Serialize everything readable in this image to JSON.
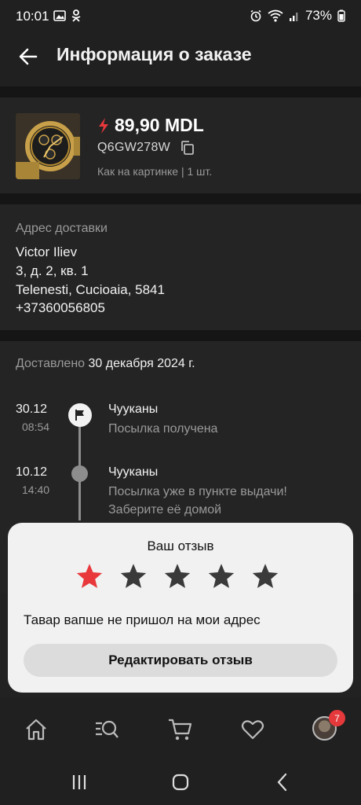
{
  "status_bar": {
    "time": "10:01",
    "battery": "73%"
  },
  "header": {
    "title": "Информация о заказе"
  },
  "product": {
    "price": "89,90 MDL",
    "sku": "Q6GW278W",
    "variant": "Как на картинке | 1 шт."
  },
  "address": {
    "label": "Адрес доставки",
    "name": "Victor Iliev",
    "line1": "3, д. 2, кв. 1",
    "line2": "Telenesti, Cucioaia, 5841",
    "phone": "+37360056805"
  },
  "delivery": {
    "label": "Доставлено",
    "date": "30 декабря 2024 г.",
    "events": [
      {
        "date": "30.12",
        "time": "08:54",
        "place": "Чууканы",
        "status": "Посылка получена"
      },
      {
        "date": "10.12",
        "time": "14:40",
        "place": "Чууканы",
        "status": "Посылка уже в пункте выдачи! Заберите её домой"
      }
    ]
  },
  "review": {
    "title": "Ваш отзыв",
    "rating": 1,
    "max_rating": 5,
    "text": "Тавар вапше не пришол на мои адрес",
    "edit_label": "Редактировать отзыв"
  },
  "bottom_nav": {
    "account_badge": "7"
  },
  "colors": {
    "accent": "#e8383b",
    "background": "#242424",
    "card": "#f1f1f1"
  }
}
